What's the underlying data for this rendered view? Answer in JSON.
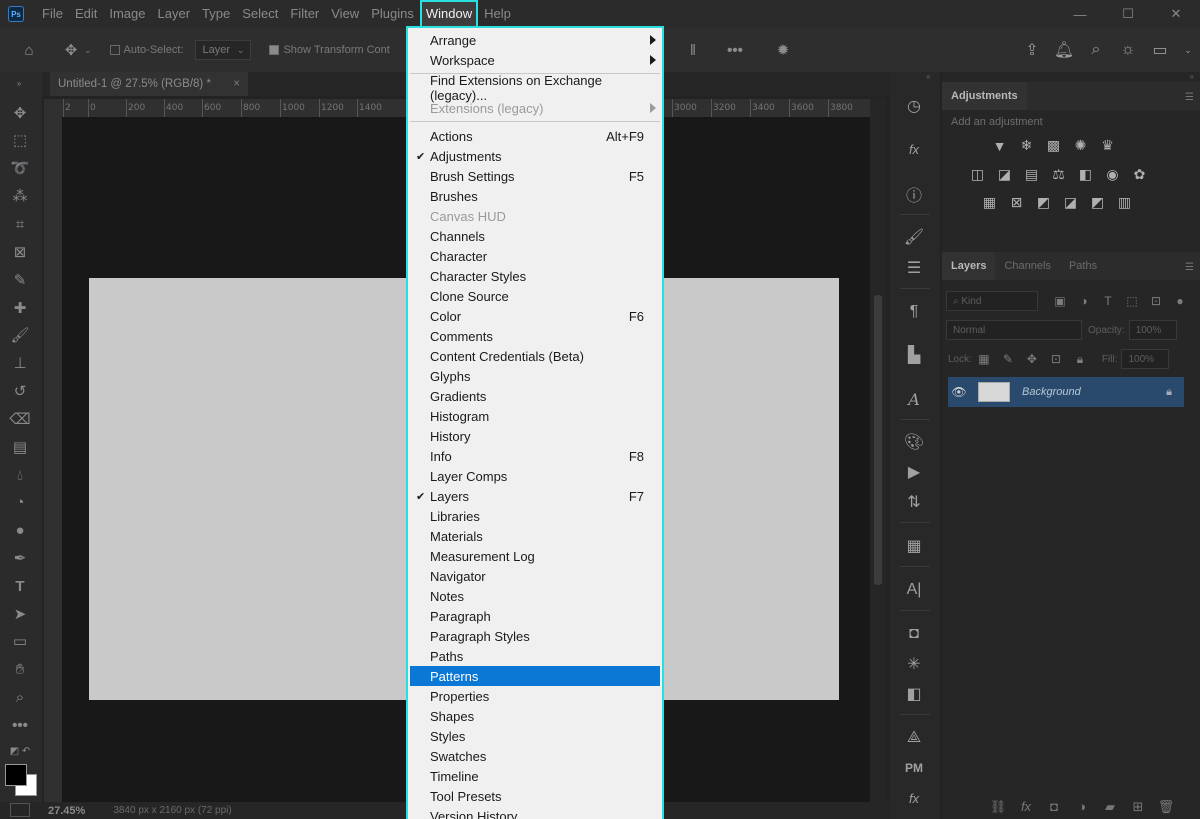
{
  "menubar": {
    "items": [
      "File",
      "Edit",
      "Image",
      "Layer",
      "Type",
      "Select",
      "Filter",
      "View",
      "Plugins",
      "Window",
      "Help"
    ],
    "active": "Window",
    "logo": "Ps"
  },
  "options": {
    "auto_select_label": "Auto-Select:",
    "auto_select_value": "Layer",
    "show_transform_label": "Show Transform Cont"
  },
  "document": {
    "tab_title": "Untitled-1 @ 27.5% (RGB/8) *",
    "ruler_ticks": [
      "2",
      "0",
      "200",
      "400",
      "600",
      "800",
      "1000",
      "1200",
      "1400",
      "3000",
      "3200",
      "3400",
      "3600",
      "3800"
    ],
    "zoom": "27.45%",
    "size_info": "3840 px x 2160 px (72 ppi)"
  },
  "panels": {
    "adjustments": {
      "tab": "Adjustments",
      "subtitle": "Add an adjustment"
    },
    "layers": {
      "tabs": [
        "Layers",
        "Channels",
        "Paths"
      ],
      "kind_placeholder": "Kind",
      "blend_mode": "Normal",
      "opacity_label": "Opacity:",
      "opacity_value": "100%",
      "lock_label": "Lock:",
      "fill_label": "Fill:",
      "fill_value": "100%",
      "layer_name": "Background"
    }
  },
  "window_menu": {
    "items": [
      {
        "label": "Arrange",
        "submenu": true
      },
      {
        "label": "Workspace",
        "submenu": true
      },
      {
        "separator": true
      },
      {
        "label": "Find Extensions on Exchange (legacy)..."
      },
      {
        "label": "Extensions (legacy)",
        "submenu": true,
        "disabled": true
      },
      {
        "separator": true
      },
      {
        "label": "Actions",
        "shortcut": "Alt+F9"
      },
      {
        "label": "Adjustments",
        "checked": true
      },
      {
        "label": "Brush Settings",
        "shortcut": "F5"
      },
      {
        "label": "Brushes"
      },
      {
        "label": "Canvas HUD",
        "disabled": true
      },
      {
        "label": "Channels"
      },
      {
        "label": "Character"
      },
      {
        "label": "Character Styles"
      },
      {
        "label": "Clone Source"
      },
      {
        "label": "Color",
        "shortcut": "F6"
      },
      {
        "label": "Comments"
      },
      {
        "label": "Content Credentials (Beta)"
      },
      {
        "label": "Glyphs"
      },
      {
        "label": "Gradients"
      },
      {
        "label": "Histogram"
      },
      {
        "label": "History"
      },
      {
        "label": "Info",
        "shortcut": "F8"
      },
      {
        "label": "Layer Comps"
      },
      {
        "label": "Layers",
        "checked": true,
        "shortcut": "F7"
      },
      {
        "label": "Libraries"
      },
      {
        "label": "Materials"
      },
      {
        "label": "Measurement Log"
      },
      {
        "label": "Navigator"
      },
      {
        "label": "Notes"
      },
      {
        "label": "Paragraph"
      },
      {
        "label": "Paragraph Styles"
      },
      {
        "label": "Paths"
      },
      {
        "label": "Patterns",
        "highlighted": true
      },
      {
        "label": "Properties"
      },
      {
        "label": "Shapes"
      },
      {
        "label": "Styles"
      },
      {
        "label": "Swatches"
      },
      {
        "label": "Timeline"
      },
      {
        "label": "Tool Presets"
      },
      {
        "label": "Version History"
      }
    ]
  },
  "colors": {
    "highlight": "#0a78d4",
    "menu_outline": "#29e0e0",
    "selected_layer": "#294a6c"
  }
}
